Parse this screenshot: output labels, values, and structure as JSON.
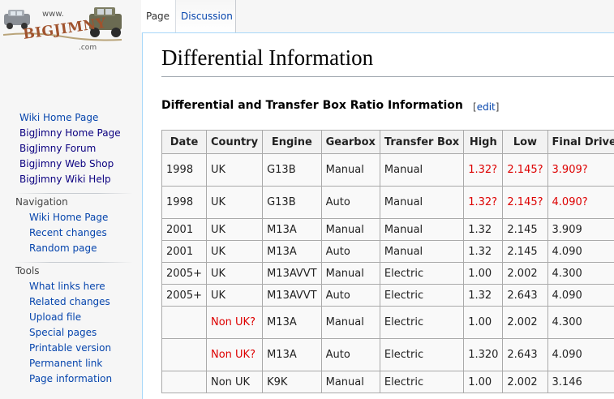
{
  "logo": {
    "www": "www.",
    "word": "BIGJIMNY",
    "com": ".com"
  },
  "sidebar": {
    "main_links": [
      "Wiki Home Page",
      "BigJimny Home Page",
      "BigJimny Forum",
      "Bigjimny Web Shop",
      "BigJimny Wiki Help"
    ],
    "navigation": {
      "heading": "Navigation",
      "items": [
        "Wiki Home Page",
        "Recent changes",
        "Random page"
      ]
    },
    "tools": {
      "heading": "Tools",
      "items": [
        "What links here",
        "Related changes",
        "Upload file",
        "Special pages",
        "Printable version",
        "Permanent link",
        "Page information"
      ]
    }
  },
  "tabs": {
    "page": "Page",
    "discussion": "Discussion"
  },
  "content": {
    "title": "Differential Information",
    "section_heading": "Differential and Transfer Box Ratio Information",
    "edit_open": "[",
    "edit_label": "edit",
    "edit_close": "]"
  },
  "table": {
    "headers": [
      "Date",
      "Country",
      "Engine",
      "Gearbox",
      "Transfer Box",
      "High",
      "Low",
      "Final Drive"
    ],
    "rows": [
      [
        "1998",
        "UK",
        "G13B",
        "Manual",
        "Manual",
        "1.32?",
        "2.145?",
        "3.909?"
      ],
      [
        "1998",
        "UK",
        "G13B",
        "Auto",
        "Manual",
        "1.32?",
        "2.145?",
        "4.090?"
      ],
      [
        "2001",
        "UK",
        "M13A",
        "Manual",
        "Manual",
        "1.32",
        "2.145",
        "3.909"
      ],
      [
        "2001",
        "UK",
        "M13A",
        "Auto",
        "Manual",
        "1.32",
        "2.145",
        "4.090"
      ],
      [
        "2005+",
        "UK",
        "M13AVVT",
        "Manual",
        "Electric",
        "1.00",
        "2.002",
        "4.300"
      ],
      [
        "2005+",
        "UK",
        "M13AVVT",
        "Auto",
        "Electric",
        "1.32",
        "2.643",
        "4.090"
      ],
      [
        "",
        "Non UK?",
        "M13A",
        "Manual",
        "Electric",
        "1.00",
        "2.002",
        "4.300"
      ],
      [
        "",
        "Non UK?",
        "M13A",
        "Auto",
        "Electric",
        "1.320",
        "2.643",
        "4.090"
      ],
      [
        "",
        "Non UK",
        "K9K",
        "Manual",
        "Electric",
        "1.00",
        "2.002",
        "3.146"
      ]
    ],
    "uncertain_color": "#dd0000"
  }
}
